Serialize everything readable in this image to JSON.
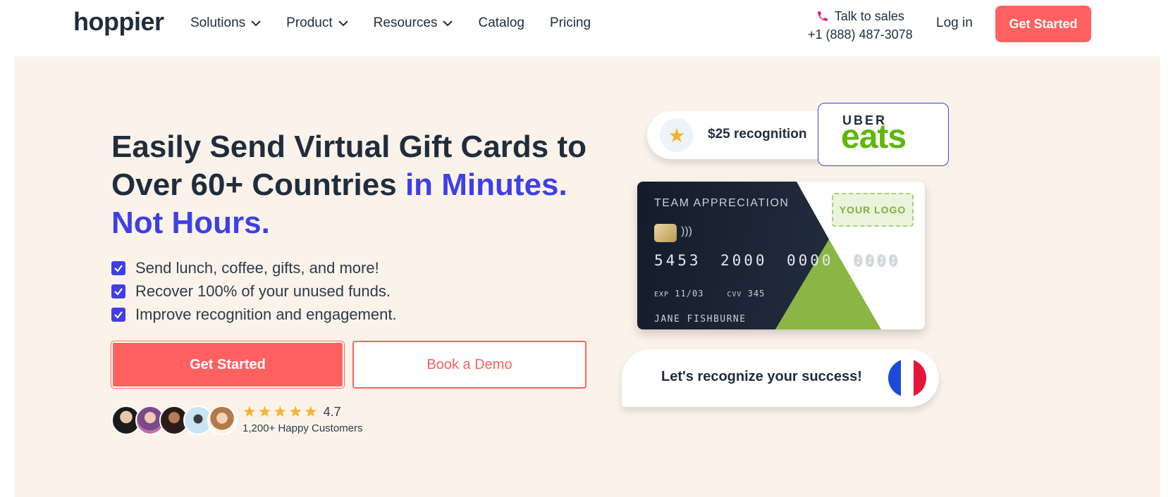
{
  "nav": {
    "logo": "hoppier",
    "menu": [
      {
        "label": "Solutions",
        "has_dropdown": true
      },
      {
        "label": "Product",
        "has_dropdown": true
      },
      {
        "label": "Resources",
        "has_dropdown": true
      },
      {
        "label": "Catalog",
        "has_dropdown": false
      },
      {
        "label": "Pricing",
        "has_dropdown": false
      }
    ],
    "sales_label": "Talk to sales",
    "sales_phone": "+1 (888) 487-3078",
    "login": "Log in",
    "cta": "Get Started"
  },
  "hero": {
    "headline_part1": "Easily Send Virtual Gift Cards to Over 60+ Countries ",
    "headline_accent": "in Minutes. Not Hours.",
    "bullets": [
      "Send lunch, coffee, gifts, and more!",
      "Recover 100% of your unused funds.",
      "Improve recognition and engagement."
    ],
    "primary_button": "Get Started",
    "secondary_button": "Book a Demo",
    "rating": "4.7",
    "customers": "1,200+ Happy Customers"
  },
  "cards": {
    "recognition_label": "$25 recognition",
    "brand_top": "UBER",
    "brand_bottom": "eats",
    "card_title": "TEAM APPRECIATION",
    "card_number": [
      "5453",
      "2000",
      "0000",
      "0000"
    ],
    "exp_label": "EXP",
    "exp_value": "11/03",
    "cvv_label": "CVV",
    "cvv_value": "345",
    "holder": "JANE FISHBURNE",
    "your_logo": "YOUR LOGO",
    "success_label": "Let's recognize your success!"
  },
  "colors": {
    "accent": "#3e3fe6",
    "cta": "#ff6160",
    "hero_bg": "#fbf3ea",
    "green": "#8bb545"
  }
}
